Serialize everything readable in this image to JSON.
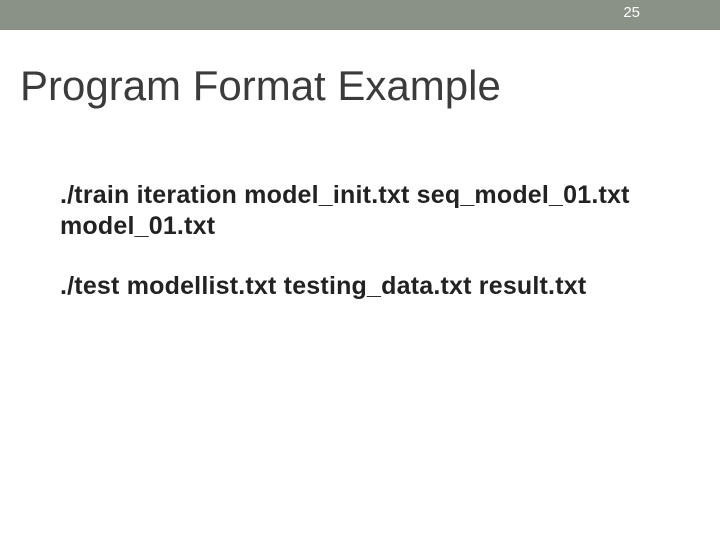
{
  "page_number": "25",
  "title": "Program Format Example",
  "commands": {
    "train": "./train iteration model_init.txt seq_model_01.txt model_01.txt",
    "test": "./test modellist.txt testing_data.txt result.txt"
  }
}
